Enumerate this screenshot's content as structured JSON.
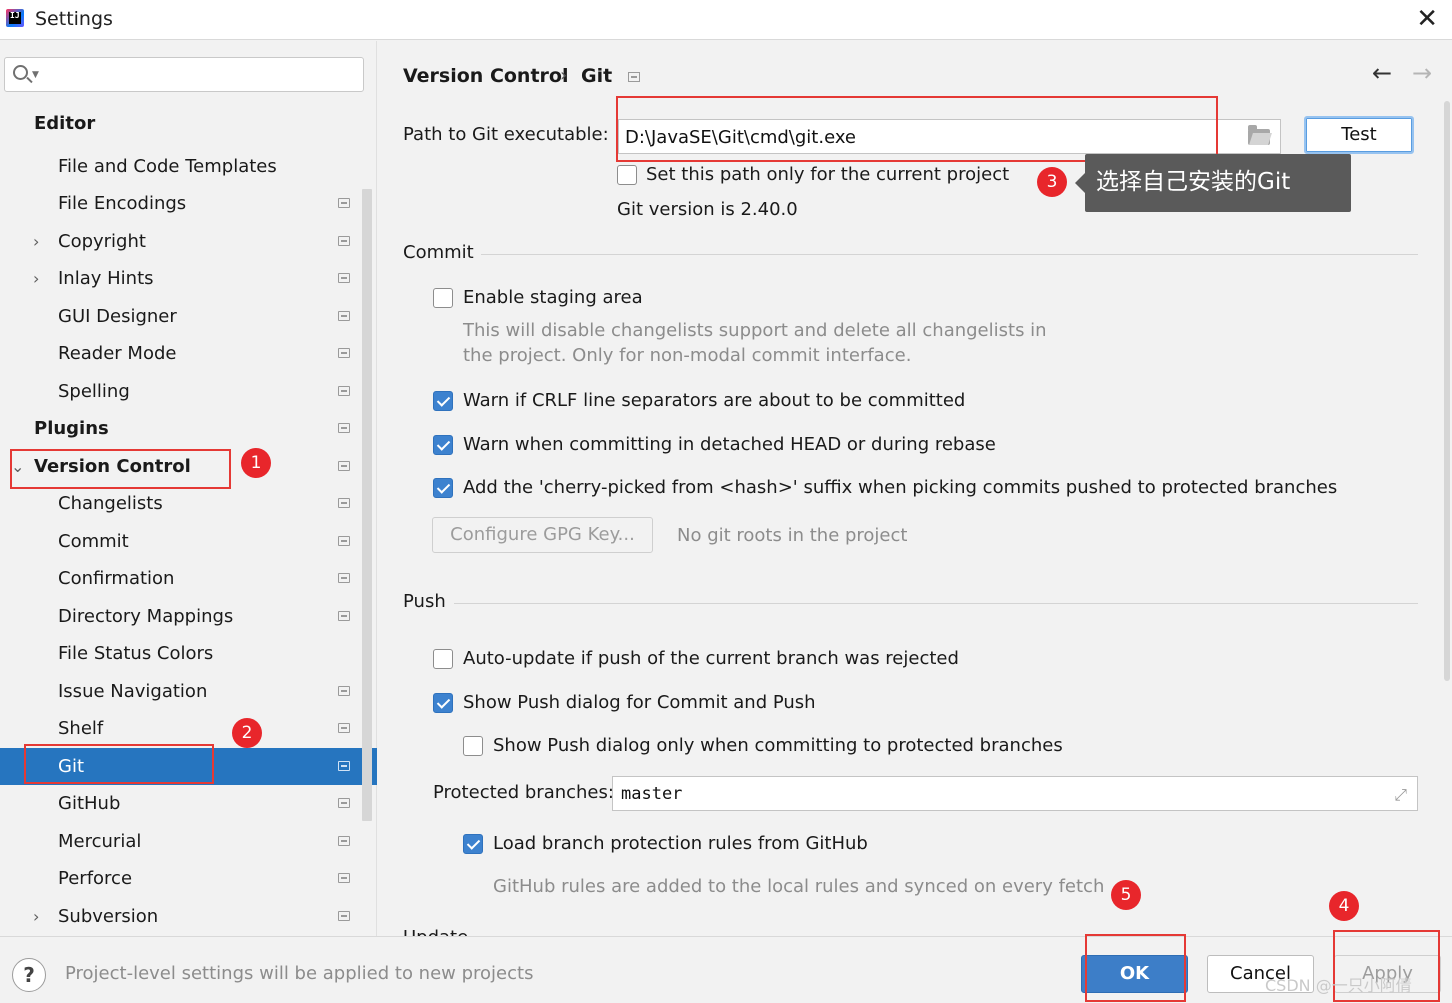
{
  "window": {
    "title": "Settings",
    "close": "✕"
  },
  "sidebar": {
    "search": {
      "placeholder": "",
      "value": ""
    },
    "items": [
      {
        "label": "Editor",
        "level": "top"
      },
      {
        "label": "File and Code Templates"
      },
      {
        "label": "File Encodings"
      },
      {
        "label": "Copyright",
        "expandable": true
      },
      {
        "label": "Inlay Hints",
        "expandable": true
      },
      {
        "label": "GUI Designer"
      },
      {
        "label": "Reader Mode"
      },
      {
        "label": "Spelling"
      },
      {
        "label": "Plugins",
        "level": "top"
      },
      {
        "label": "Version Control",
        "level": "top",
        "expanded": true
      },
      {
        "label": "Changelists"
      },
      {
        "label": "Commit"
      },
      {
        "label": "Confirmation"
      },
      {
        "label": "Directory Mappings"
      },
      {
        "label": "File Status Colors"
      },
      {
        "label": "Issue Navigation"
      },
      {
        "label": "Shelf"
      },
      {
        "label": "Git",
        "selected": true
      },
      {
        "label": "GitHub"
      },
      {
        "label": "Mercurial"
      },
      {
        "label": "Perforce"
      },
      {
        "label": "Subversion",
        "expandable": true
      }
    ]
  },
  "main": {
    "breadcrumb": {
      "parent": "Version Control",
      "sep": "›",
      "current": "Git"
    },
    "nav": {
      "back": "←",
      "forward": "→"
    },
    "path": {
      "label": "Path to Git executable:",
      "value": "D:\\JavaSE\\Git\\cmd\\git.exe",
      "test_button": "Test",
      "current_project_only": "Set this path only for the current project",
      "version": "Git version is 2.40.0"
    },
    "commit": {
      "header": "Commit",
      "staging": "Enable staging area",
      "staging_note_1": "This will disable changelists support and delete all changelists in",
      "staging_note_2": "the project. Only for non-modal commit interface.",
      "warn_crlf": "Warn if CRLF line separators are about to be committed",
      "warn_detached": "Warn when committing in detached HEAD or during rebase",
      "cherry_pick": "Add the 'cherry-picked from <hash>' suffix when picking commits pushed to protected branches",
      "gpg_button": "Configure GPG Key...",
      "gpg_note": "No git roots in the project"
    },
    "push": {
      "header": "Push",
      "auto_update": "Auto-update if push of the current branch was rejected",
      "show_dialog": "Show Push dialog for Commit and Push",
      "show_dialog_protected": "Show Push dialog only when committing to protected branches",
      "protected_label": "Protected branches:",
      "protected_value": "master",
      "load_rules": "Load branch protection rules from GitHub",
      "rules_note": "GitHub rules are added to the local rules and synced on every fetch"
    },
    "update_header": "Update"
  },
  "footer": {
    "help": "?",
    "note": "Project-level settings will be applied to new projects",
    "ok": "OK",
    "cancel": "Cancel",
    "apply": "Apply"
  },
  "annotations": {
    "badges": [
      "1",
      "2",
      "3",
      "4",
      "5"
    ],
    "tooltip": "选择自己安装的Git",
    "watermark": "CSDN @一只小阿倩"
  },
  "colors": {
    "selection": "#2675bf",
    "checkbox": "#3d82cf",
    "annotation": "#e53935"
  }
}
